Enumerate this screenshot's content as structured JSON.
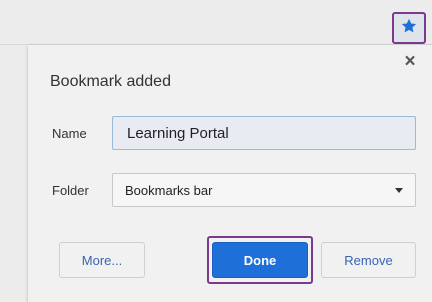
{
  "toolbar": {
    "star_icon": "star-icon",
    "accent_color": "#1f6fd8",
    "highlight_color": "#7b3a8e"
  },
  "dialog": {
    "title": "Bookmark added",
    "close_glyph": "×",
    "name_label": "Name",
    "name_value": "Learning Portal",
    "folder_label": "Folder",
    "folder_value": "Bookmarks bar",
    "buttons": {
      "more": "More...",
      "done": "Done",
      "remove": "Remove"
    }
  }
}
